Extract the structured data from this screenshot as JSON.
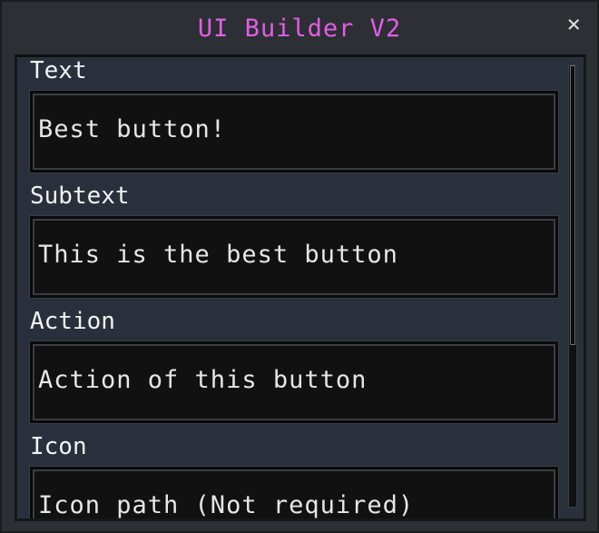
{
  "window": {
    "title": "UI Builder V2",
    "close_glyph": "×"
  },
  "fields": [
    {
      "label": "Text",
      "value": "Best button!"
    },
    {
      "label": "Subtext",
      "value": "This is the best button"
    },
    {
      "label": "Action",
      "value": "Action of this button"
    },
    {
      "label": "Icon",
      "value": "Icon path (Not required)"
    }
  ],
  "colors": {
    "title": "#e25ee8",
    "panel_bg": "#2a303b",
    "field_bg": "#111111",
    "text": "#f2f2f2"
  },
  "icons": {
    "close": "close-icon"
  }
}
